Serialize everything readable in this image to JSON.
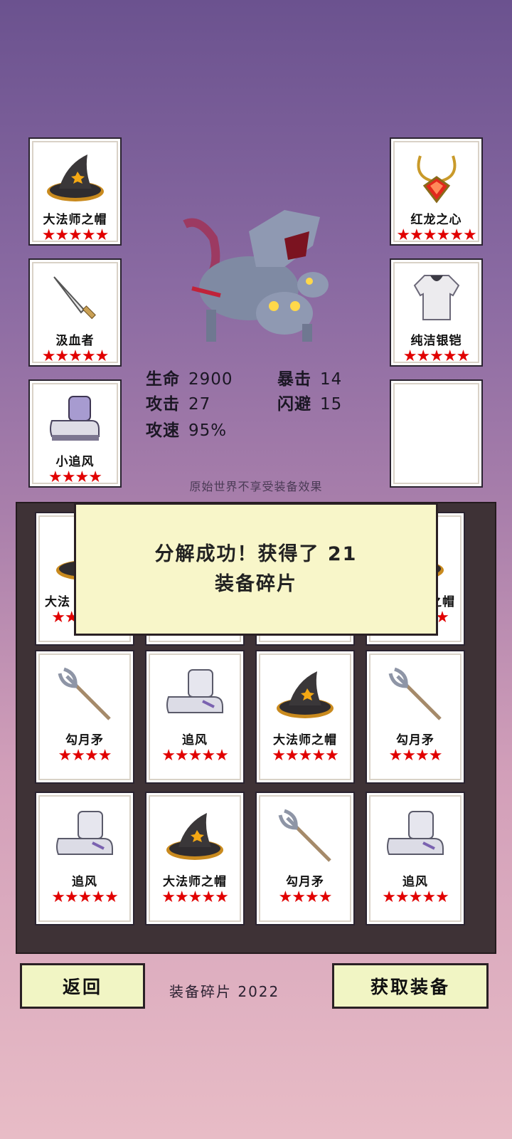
{
  "equipment": {
    "left": [
      {
        "name": "大法师之帽",
        "stars": "★★★★★",
        "icon": "wizard-hat-icon"
      },
      {
        "name": "汲血者",
        "stars": "★★★★★",
        "icon": "dagger-icon"
      },
      {
        "name": "小追风",
        "stars": "★★★★",
        "icon": "boot-icon"
      }
    ],
    "right": [
      {
        "name": "红龙之心",
        "stars": "★★★★★★",
        "icon": "amulet-icon"
      },
      {
        "name": "纯洁银铠",
        "stars": "★★★★★",
        "icon": "armor-icon"
      }
    ]
  },
  "stats": {
    "hp_label": "生命",
    "hp": "2900",
    "crit_label": "暴击",
    "crit": "14",
    "atk_label": "攻击",
    "atk": "27",
    "dodge_label": "闪避",
    "dodge": "15",
    "aspd_label": "攻速",
    "aspd": "95%"
  },
  "note": "原始世界不享受装备效果",
  "inventory": {
    "row1_partial": [
      {
        "name": "大法",
        "stars": "★★★★★"
      },
      {
        "name": "",
        "stars": "★★★★★"
      },
      {
        "name": "",
        "stars": "★★★★★"
      },
      {
        "name": "之帽",
        "stars": "★★★★★"
      }
    ],
    "row2": [
      {
        "name": "勾月矛",
        "stars": "★★★★",
        "icon": "trident-icon"
      },
      {
        "name": "追风",
        "stars": "★★★★★",
        "icon": "boot-icon"
      },
      {
        "name": "大法师之帽",
        "stars": "★★★★★",
        "icon": "wizard-hat-icon"
      },
      {
        "name": "勾月矛",
        "stars": "★★★★",
        "icon": "trident-icon"
      }
    ],
    "row3": [
      {
        "name": "追风",
        "stars": "★★★★★",
        "icon": "boot-icon"
      },
      {
        "name": "大法师之帽",
        "stars": "★★★★★",
        "icon": "wizard-hat-icon"
      },
      {
        "name": "勾月矛",
        "stars": "★★★★",
        "icon": "trident-icon"
      },
      {
        "name": "追风",
        "stars": "★★★★★",
        "icon": "boot-icon"
      }
    ]
  },
  "dialog": {
    "line1": "分解成功！获得了 21",
    "line2": "装备碎片"
  },
  "footer": {
    "back": "返回",
    "fragments": "装备碎片 2022",
    "obtain": "获取装备"
  }
}
